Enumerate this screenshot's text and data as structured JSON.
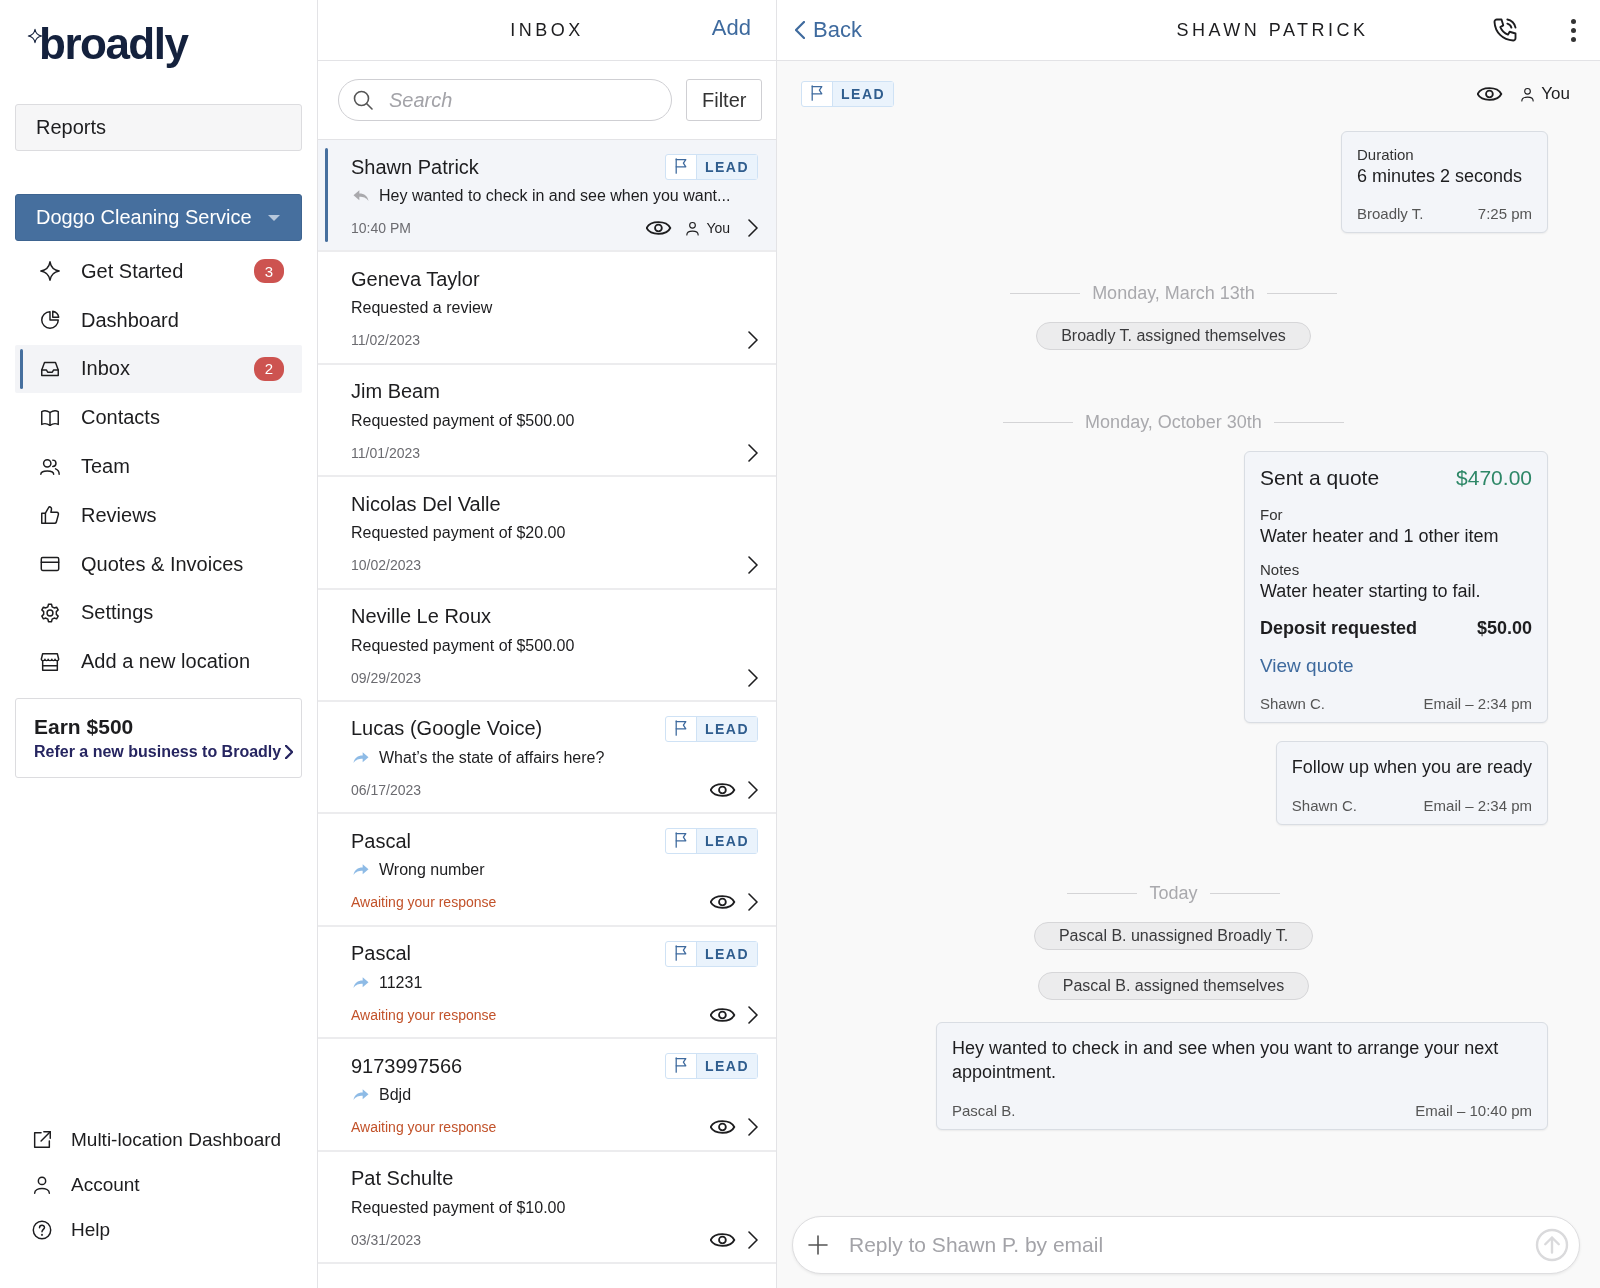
{
  "sidebar": {
    "logo": "broadly",
    "reports": "Reports",
    "location": "Doggo Cleaning Service",
    "nav": [
      {
        "label": "Get Started",
        "badge": "3",
        "selected": false
      },
      {
        "label": "Dashboard",
        "selected": false
      },
      {
        "label": "Inbox",
        "badge": "2",
        "selected": true
      },
      {
        "label": "Contacts",
        "selected": false
      },
      {
        "label": "Team",
        "selected": false
      },
      {
        "label": "Reviews",
        "selected": false
      },
      {
        "label": "Quotes & Invoices",
        "selected": false
      },
      {
        "label": "Settings",
        "selected": false
      },
      {
        "label": "Add a new location",
        "selected": false
      }
    ],
    "promo": {
      "title": "Earn $500",
      "link": "Refer a new business to Broadly"
    },
    "footer": [
      {
        "label": "Multi-location Dashboard"
      },
      {
        "label": "Account"
      },
      {
        "label": "Help"
      }
    ]
  },
  "inbox": {
    "title": "INBOX",
    "add": "Add",
    "search": {
      "placeholder": "Search"
    },
    "filter": "Filter",
    "conversations": [
      {
        "kind": "reply",
        "name": "Shawn Patrick",
        "tag": "LEAD",
        "preview": "Hey wanted to check in and see when you want...",
        "meta": "10:40 PM",
        "awaiting": false,
        "watched": true,
        "assignee": "You",
        "selected": true
      },
      {
        "kind": "request",
        "name": "Geneva Taylor",
        "preview": "Requested a review",
        "meta": "11/02/2023",
        "awaiting": false,
        "watched": false,
        "selected": false
      },
      {
        "kind": "request",
        "name": "Jim Beam",
        "preview": "Requested payment of $500.00",
        "meta": "11/01/2023",
        "awaiting": false,
        "watched": false,
        "selected": false
      },
      {
        "kind": "request",
        "name": "Nicolas Del Valle",
        "preview": "Requested payment of $20.00",
        "meta": "10/02/2023",
        "awaiting": false,
        "watched": false,
        "selected": false
      },
      {
        "kind": "request",
        "name": "Neville Le Roux",
        "preview": "Requested payment of $500.00",
        "meta": "09/29/2023",
        "awaiting": false,
        "watched": false,
        "selected": false
      },
      {
        "kind": "incoming",
        "name": "Lucas (Google Voice)",
        "tag": "LEAD",
        "preview": "What’s the state of affairs here?",
        "meta": "06/17/2023",
        "awaiting": false,
        "watched": true,
        "selected": false
      },
      {
        "kind": "incoming",
        "name": "Pascal",
        "tag": "LEAD",
        "preview": "Wrong number",
        "meta": "Awaiting your response",
        "awaiting": true,
        "watched": true,
        "selected": false
      },
      {
        "kind": "incoming",
        "name": "Pascal",
        "tag": "LEAD",
        "preview": "11231",
        "meta": "Awaiting your response",
        "awaiting": true,
        "watched": true,
        "selected": false
      },
      {
        "kind": "incoming",
        "name": "9173997566",
        "tag": "LEAD",
        "preview": "Bdjd",
        "meta": "Awaiting your response",
        "awaiting": true,
        "watched": true,
        "selected": false
      },
      {
        "kind": "request",
        "name": "Pat Schulte",
        "preview": "Requested payment of $10.00",
        "meta": "03/31/2023",
        "awaiting": false,
        "watched": true,
        "selected": false
      }
    ]
  },
  "conversation": {
    "back": "Back",
    "title": "SHAWN PATRICK",
    "tag": "LEAD",
    "watched": true,
    "assignee": "You",
    "timeline": [
      {
        "kind": "call",
        "label": "Duration",
        "value": "6 minutes 2 seconds",
        "author": "Broadly T.",
        "meta": "7:25 pm"
      },
      {
        "kind": "date",
        "text": "Monday, March 13th"
      },
      {
        "kind": "event",
        "text": "Broadly T. assigned themselves"
      },
      {
        "kind": "date",
        "text": "Monday, October 30th"
      },
      {
        "kind": "quote",
        "title": "Sent a quote",
        "amount": "$470.00",
        "fields": [
          {
            "label": "For",
            "value": "Water heater and 1 other item"
          },
          {
            "label": "Notes",
            "value": "Water heater starting to fail."
          }
        ],
        "deposit_label": "Deposit requested",
        "deposit": "$50.00",
        "link": "View quote",
        "author": "Shawn C.",
        "meta": "Email – 2:34 pm"
      },
      {
        "kind": "message",
        "text": "Follow up when you are ready",
        "author": "Shawn C.",
        "meta": "Email – 2:34 pm"
      },
      {
        "kind": "date",
        "text": "Today"
      },
      {
        "kind": "event",
        "text": "Pascal B. unassigned Broadly T."
      },
      {
        "kind": "event",
        "text": "Pascal B. assigned themselves"
      },
      {
        "kind": "message",
        "text": "Hey wanted to check in and see when you want to arrange your next appointment.",
        "author": "Pascal B.",
        "meta": "Email – 10:40 pm"
      }
    ],
    "reply": {
      "placeholder": "Reply to Shawn P. by email"
    }
  }
}
